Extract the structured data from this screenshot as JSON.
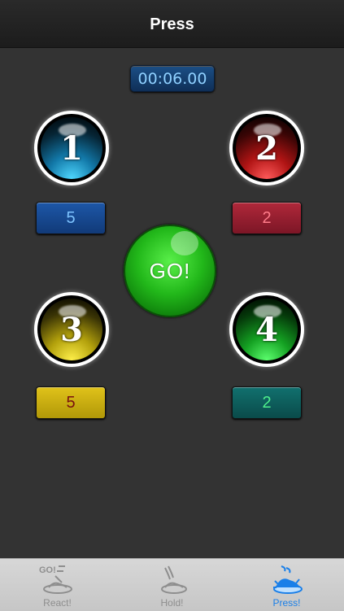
{
  "header": {
    "title": "Press"
  },
  "timer": {
    "value": "00:06.00"
  },
  "players": [
    {
      "number": "1",
      "color": "#1fb4ec",
      "score": "5"
    },
    {
      "number": "2",
      "color": "#d81a1a",
      "score": "2"
    },
    {
      "number": "3",
      "color": "#e8d216",
      "score": "5"
    },
    {
      "number": "4",
      "color": "#22d12c",
      "score": "2"
    }
  ],
  "go_button": {
    "label": "GO!"
  },
  "tabs": [
    {
      "label": "React!",
      "icon": "react-go-hand-icon",
      "icon_text": "GO!",
      "active": false
    },
    {
      "label": "Hold!",
      "icon": "hold-hand-icon",
      "active": false
    },
    {
      "label": "Press!",
      "icon": "press-hand-icon",
      "active": true
    }
  ],
  "colors": {
    "accent": "#1a7fe8",
    "background": "#333333"
  }
}
